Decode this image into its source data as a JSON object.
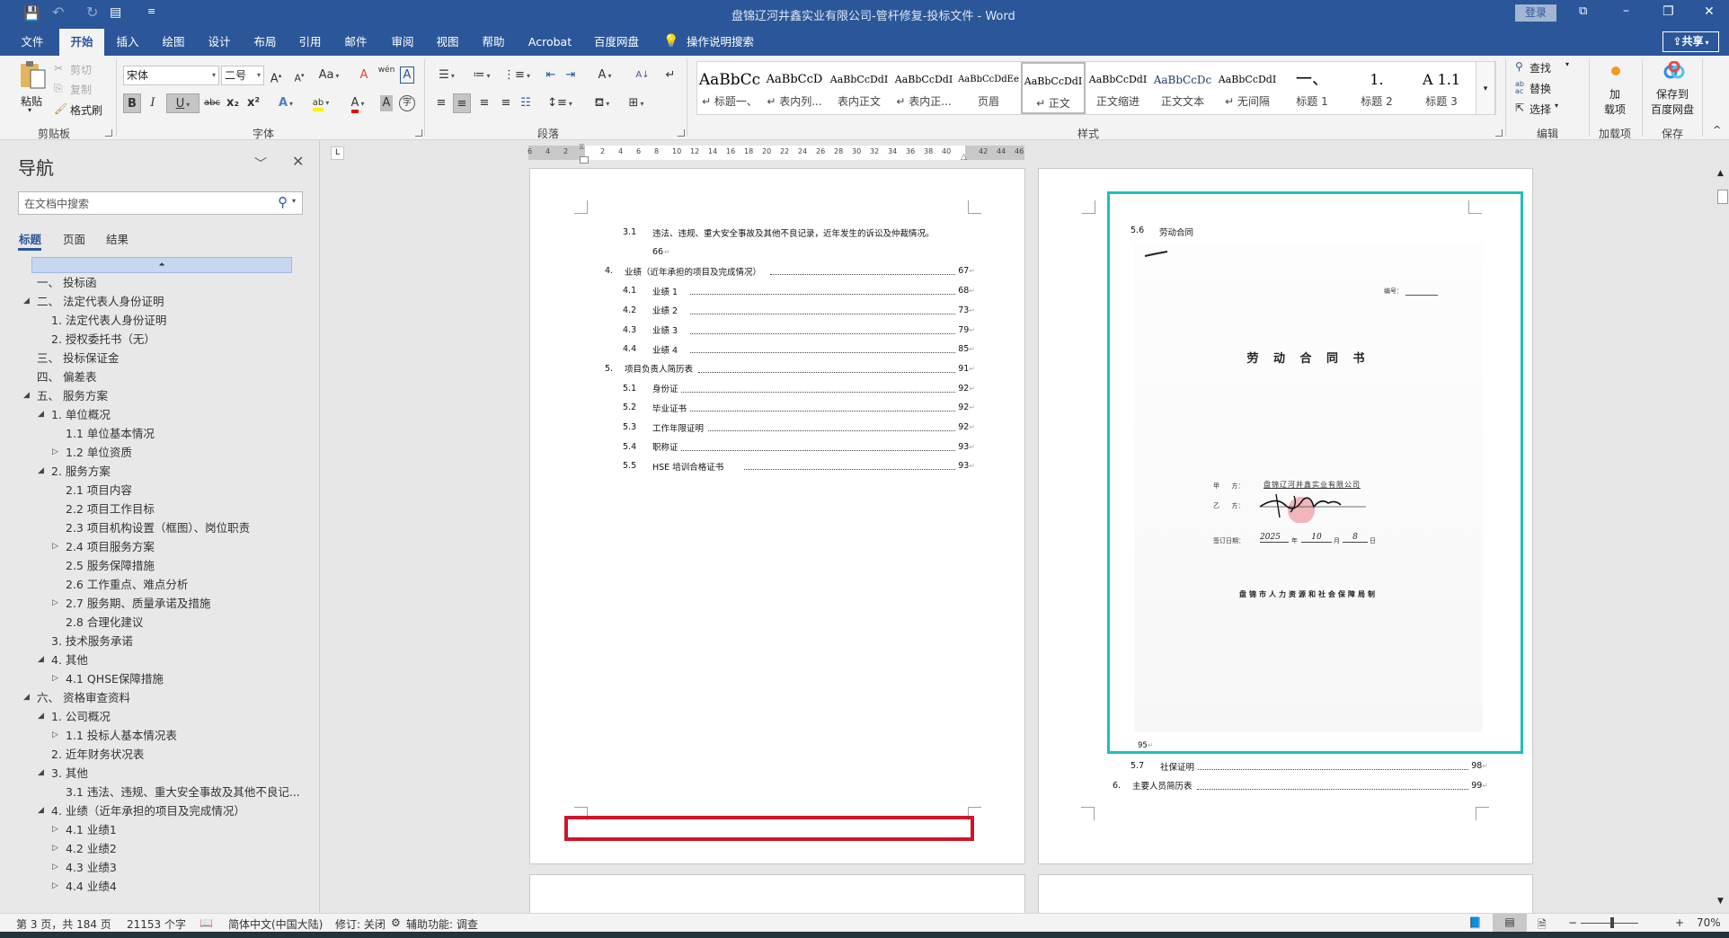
{
  "window": {
    "title": "盘锦辽河井鑫实业有限公司-管杆修复-投标文件  -  Word",
    "login_label": "登录",
    "share_label": "共享",
    "minimize": "–",
    "restore": "❐",
    "close": "✕",
    "ribbon_display": "⧉"
  },
  "qat": {
    "save": "💾",
    "undo": "↶",
    "redo": "↻",
    "new_doc": "▤",
    "customize": "≡"
  },
  "tabs": [
    "文件",
    "开始",
    "插入",
    "绘图",
    "设计",
    "布局",
    "引用",
    "邮件",
    "审阅",
    "视图",
    "帮助",
    "Acrobat",
    "百度网盘"
  ],
  "active_tab": "开始",
  "tell_me": "操作说明搜索",
  "ribbon": {
    "clipboard": {
      "paste": "粘贴",
      "cut": "剪切",
      "copy": "复制",
      "format_painter": "格式刷",
      "label": "剪贴板"
    },
    "font": {
      "font_name": "宋体",
      "font_size": "二号",
      "grow": "A",
      "shrink": "A",
      "change_case": "Aa",
      "clear": "A",
      "phonetic": "wén",
      "border": "A",
      "bold": "B",
      "italic": "I",
      "underline": "U",
      "strike": "abc",
      "sub": "x₂",
      "sup": "x²",
      "effects": "A",
      "highlight": "ab",
      "color": "A",
      "shading": "A",
      "enclose": "字",
      "label": "字体"
    },
    "paragraph": {
      "label": "段落",
      "asian_layout": "A",
      "sort": "A↓",
      "marks": "↵"
    },
    "styles": {
      "label": "样式",
      "items": [
        {
          "preview": "AaBbCc",
          "name": "↵ 标题一、"
        },
        {
          "preview": "AaBbCcD",
          "name": "↵ 表内列..."
        },
        {
          "preview": "AaBbCcDdI",
          "name": "表内正文"
        },
        {
          "preview": "AaBbCcDdI",
          "name": "↵ 表内正..."
        },
        {
          "preview": "AaBbCcDdEe",
          "name": "页眉"
        },
        {
          "preview": "AaBbCcDdI",
          "name": "↵ 正文"
        },
        {
          "preview": "AaBbCcDdI",
          "name": "正文缩进"
        },
        {
          "preview": "AaBbCcDc",
          "name": "正文文本"
        },
        {
          "preview": "AaBbCcDdI",
          "name": "↵ 无间隔"
        },
        {
          "preview": "一、",
          "name": "标题 1"
        },
        {
          "preview": "1.",
          "name": "标题 2"
        },
        {
          "preview": "A  1.1",
          "name": "标题 3"
        }
      ],
      "selected": "↵ 正文"
    },
    "editing": {
      "find": "查找",
      "replace": "替换",
      "select": "选择",
      "label": "编辑"
    },
    "addins": {
      "button": [
        "加",
        "载项"
      ],
      "label": "加载项"
    },
    "save": {
      "button": [
        "保存到",
        "百度网盘"
      ],
      "label": "保存"
    }
  },
  "ruler": {
    "left_labels": [
      "6",
      "4",
      "2"
    ],
    "labels": [
      "2",
      "4",
      "6",
      "8",
      "10",
      "12",
      "14",
      "16",
      "18",
      "20",
      "22",
      "24",
      "26",
      "28",
      "30",
      "32",
      "34",
      "36",
      "38",
      "40"
    ],
    "right_labels": [
      "42",
      "44",
      "46"
    ]
  },
  "nav": {
    "title": "导航",
    "search_placeholder": "在文档中搜索",
    "tabs": [
      "标题",
      "页面",
      "结果"
    ],
    "items": [
      {
        "label": "一、  投标函",
        "level": 0,
        "toggle": ""
      },
      {
        "label": "二、  法定代表人身份证明",
        "level": 0,
        "toggle": "expanded"
      },
      {
        "label": "1. 法定代表人身份证明",
        "level": 1,
        "toggle": ""
      },
      {
        "label": "2. 授权委托书（无）",
        "level": 1,
        "toggle": ""
      },
      {
        "label": "三、  投标保证金",
        "level": 0,
        "toggle": ""
      },
      {
        "label": "四、  偏差表",
        "level": 0,
        "toggle": ""
      },
      {
        "label": "五、  服务方案",
        "level": 0,
        "toggle": "expanded"
      },
      {
        "label": "1. 单位概况",
        "level": 1,
        "toggle": "expanded"
      },
      {
        "label": "1.1 单位基本情况",
        "level": 2,
        "toggle": ""
      },
      {
        "label": "1.2 单位资质",
        "level": 2,
        "toggle": "collapsed"
      },
      {
        "label": "2. 服务方案",
        "level": 1,
        "toggle": "expanded"
      },
      {
        "label": "2.1 项目内容",
        "level": 2,
        "toggle": ""
      },
      {
        "label": "2.2 项目工作目标",
        "level": 2,
        "toggle": ""
      },
      {
        "label": "2.3 项目机构设置（框图）、岗位职责",
        "level": 2,
        "toggle": ""
      },
      {
        "label": "2.4 项目服务方案",
        "level": 2,
        "toggle": "collapsed"
      },
      {
        "label": "2.5 服务保障措施",
        "level": 2,
        "toggle": ""
      },
      {
        "label": "2.6 工作重点、难点分析",
        "level": 2,
        "toggle": ""
      },
      {
        "label": "2.7 服务期、质量承诺及措施",
        "level": 2,
        "toggle": "collapsed"
      },
      {
        "label": "2.8 合理化建议",
        "level": 2,
        "toggle": ""
      },
      {
        "label": "3. 技术服务承诺",
        "level": 1,
        "toggle": ""
      },
      {
        "label": "4. 其他",
        "level": 1,
        "toggle": "expanded"
      },
      {
        "label": "4.1 QHSE保障措施",
        "level": 2,
        "toggle": "collapsed"
      },
      {
        "label": "六、  资格审查资料",
        "level": 0,
        "toggle": "expanded"
      },
      {
        "label": "1. 公司概况",
        "level": 1,
        "toggle": "expanded"
      },
      {
        "label": "1.1 投标人基本情况表",
        "level": 2,
        "toggle": "collapsed"
      },
      {
        "label": "2. 近年财务状况表",
        "level": 1,
        "toggle": ""
      },
      {
        "label": "3. 其他",
        "level": 1,
        "toggle": "expanded"
      },
      {
        "label": "3.1 违法、违规、重大安全事故及其他不良记...",
        "level": 2,
        "toggle": ""
      },
      {
        "label": "4. 业绩（近年承担的项目及完成情况）",
        "level": 1,
        "toggle": "expanded"
      },
      {
        "label": "4.1 业绩1",
        "level": 2,
        "toggle": "collapsed"
      },
      {
        "label": "4.2 业绩2",
        "level": 2,
        "toggle": "collapsed"
      },
      {
        "label": "4.3 业绩3",
        "level": 2,
        "toggle": "collapsed"
      },
      {
        "label": "4.4 业绩4",
        "level": 2,
        "toggle": "collapsed"
      }
    ]
  },
  "page1": {
    "toc": [
      {
        "num": "3.1",
        "text": "违法、违规、重大安全事故及其他不良记录，近年发生的诉讼及仲裁情况。",
        "page": "",
        "level": 2
      },
      {
        "num": "",
        "text": "66",
        "page": "",
        "level": 2
      },
      {
        "num": "4.",
        "text": "业绩（近年承担的项目及完成情况）",
        "page": "67",
        "level": 1
      },
      {
        "num": "4.1",
        "text": "业绩 1",
        "page": "68",
        "level": 2
      },
      {
        "num": "4.2",
        "text": "业绩 2",
        "page": "73",
        "level": 2
      },
      {
        "num": "4.3",
        "text": "业绩 3",
        "page": "79",
        "level": 2
      },
      {
        "num": "4.4",
        "text": "业绩 4",
        "page": "85",
        "level": 2
      },
      {
        "num": "5.",
        "text": "项目负责人简历表",
        "page": "91",
        "level": 1
      },
      {
        "num": "5.1",
        "text": "身份证",
        "page": "92",
        "level": 2
      },
      {
        "num": "5.2",
        "text": "毕业证书",
        "page": "92",
        "level": 2
      },
      {
        "num": "5.3",
        "text": "工作年限证明",
        "page": "92",
        "level": 2
      },
      {
        "num": "5.4",
        "text": "职称证",
        "page": "93",
        "level": 2
      },
      {
        "num": "5.5",
        "text": "HSE 培训合格证书",
        "page": "93",
        "level": 2
      }
    ]
  },
  "page2": {
    "heading_num": "5.6",
    "heading_text": "劳动合同",
    "scan": {
      "serial_label": "编号：",
      "title": "劳 动 合 同 书",
      "party_a_label": "甲      方：",
      "party_a_value": "盘锦辽河井鑫实业有限公司",
      "party_b_label": "乙      方：",
      "date_label": "签订日期：",
      "year_hand": "2025",
      "year_label": "年",
      "month_hand": "10",
      "month_label": "月",
      "day_hand": "8",
      "day_label": "日",
      "issuer": "盘锦市人力资源和社会保障局制"
    },
    "page_ref": "95",
    "toc": [
      {
        "num": "5.7",
        "text": "社保证明",
        "page": "98",
        "level": 2
      },
      {
        "num": "6.",
        "text": "主要人员简历表",
        "page": "99",
        "level": 1
      }
    ]
  },
  "highlights": {
    "teal": "#1fbfbf",
    "red": "#d0152a"
  },
  "status": {
    "page": "第 3 页，共 184 页",
    "words": "21153 个字",
    "language": "简体中文(中国大陆)",
    "track": "修订: 关闭",
    "accessibility": "辅助功能: 调查",
    "zoom": "70%"
  }
}
